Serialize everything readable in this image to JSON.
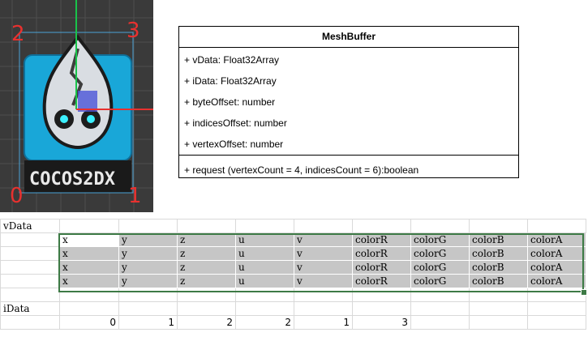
{
  "editor": {
    "corner_labels": [
      "2",
      "3",
      "0",
      "1"
    ],
    "logo_text": "COCOS2DX"
  },
  "uml": {
    "class_name": "MeshBuffer",
    "attributes": [
      "+ vData: Float32Array",
      "+ iData: Float32Array",
      "+ byteOffset: number",
      "+ indicesOffset: number",
      "+ vertexOffset: number"
    ],
    "method": "+  request (vertexCount = 4, indicesCount = 6):boolean"
  },
  "sheet": {
    "vdata_label": "vData",
    "vdata_columns": [
      "x",
      "y",
      "z",
      "u",
      "v",
      "colorR",
      "colorG",
      "colorB",
      "colorA"
    ],
    "idata_label": "iData",
    "idata_values": [
      "0",
      "1",
      "2",
      "2",
      "1",
      "3"
    ]
  }
}
